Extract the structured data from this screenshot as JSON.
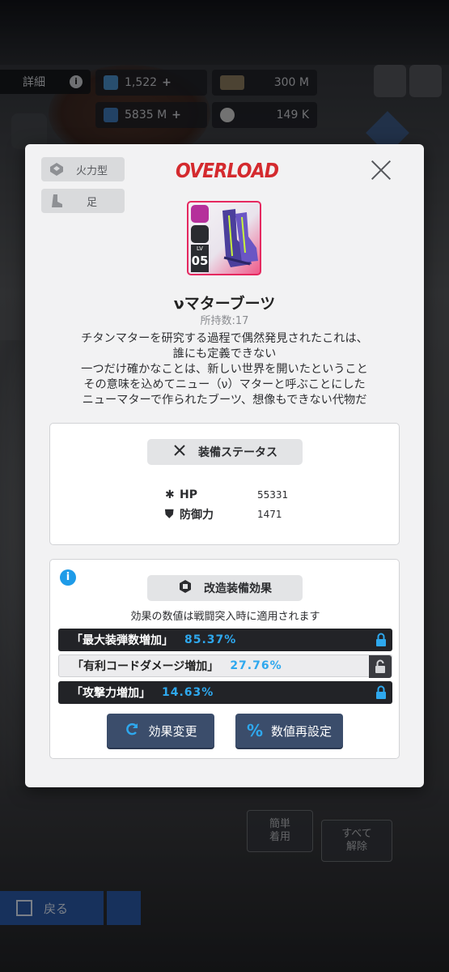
{
  "background": {
    "detail_label": "詳細",
    "info_glyph": "i",
    "resources": [
      {
        "icon": "gem-icon",
        "value": "1,522",
        "has_plus": true
      },
      {
        "icon": "ticket-icon",
        "value": "300 M",
        "has_plus": false
      },
      {
        "icon": "cube-icon",
        "value": "5835 M",
        "has_plus": true
      },
      {
        "icon": "core-icon",
        "value": "149 K",
        "has_plus": false
      }
    ],
    "plus": "+",
    "simple_equip_label": "簡単\n着用",
    "unequip_all_label": "すべて\n解除",
    "back_label": "戻る"
  },
  "modal": {
    "tags": [
      {
        "icon": "firepower-type-icon",
        "label": "火力型"
      },
      {
        "icon": "boots-slot-icon",
        "label": "足"
      }
    ],
    "header": "OVERLOAD",
    "item": {
      "level_label": "LV",
      "level": "05",
      "name": "νマターブーツ",
      "owned": "所持数:17",
      "description": [
        "チタンマターを研究する過程で偶然発見されたこれは、",
        "誰にも定義できない",
        "一つだけ確かなことは、新しい世界を開いたということ",
        "その意味を込めてニュー（ν）マターと呼ぶことにした",
        "ニューマターで作られたブーツ、想像もできない代物だ"
      ]
    },
    "status_panel": {
      "title": "装備ステータス",
      "stats": [
        {
          "icon": "hp-icon",
          "glyph": "✱",
          "label": "HP",
          "value": "55331"
        },
        {
          "icon": "defense-icon",
          "glyph": "⛊",
          "label": "防御力",
          "value": "1471"
        }
      ]
    },
    "effects_panel": {
      "title": "改造装備効果",
      "note": "効果の数値は戦闘突入時に適用されます",
      "effects": [
        {
          "name": "「最大装弾数増加」",
          "value": "85.37%",
          "locked": true,
          "style": "dark"
        },
        {
          "name": "「有利コードダメージ増加」",
          "value": "27.76%",
          "locked": false,
          "style": "light"
        },
        {
          "name": "「攻撃力増加」",
          "value": "14.63%",
          "locked": true,
          "style": "dark"
        }
      ],
      "buttons": {
        "change_effect": "効果変更",
        "reset_values": "数値再設定"
      }
    }
  },
  "colors": {
    "overload_red": "#d42a2e",
    "effect_value_blue": "#2ea8ee",
    "rarity_pink": "#e5285f",
    "action_button": "#3b4d6b"
  }
}
